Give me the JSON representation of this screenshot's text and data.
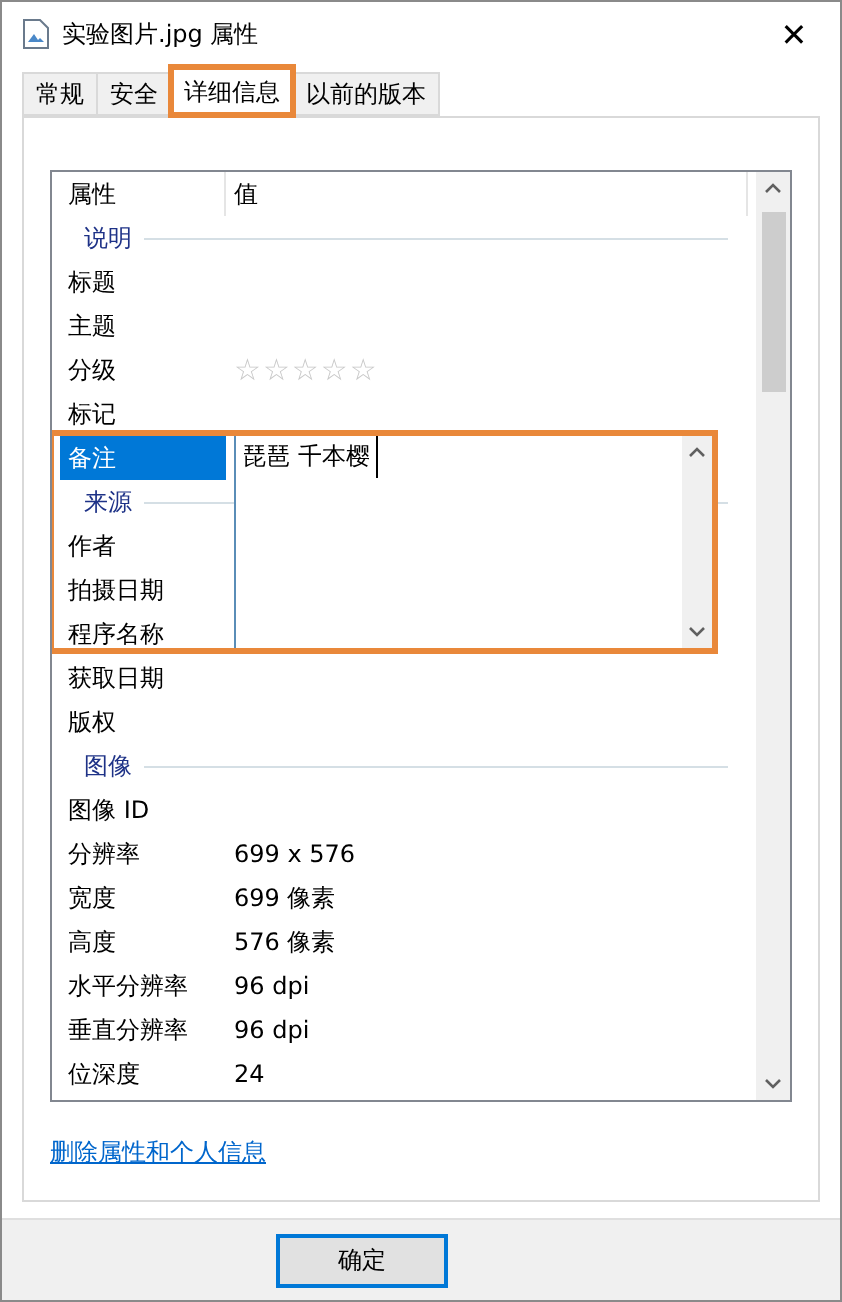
{
  "window": {
    "title": "实验图片.jpg 属性",
    "close": "✕"
  },
  "tabs": [
    {
      "label": "常规",
      "selected": false,
      "highlighted": false
    },
    {
      "label": "安全",
      "selected": false,
      "highlighted": false
    },
    {
      "label": "详细信息",
      "selected": true,
      "highlighted": true
    },
    {
      "label": "以前的版本",
      "selected": false,
      "highlighted": false
    }
  ],
  "list": {
    "columns": [
      "属性",
      "值"
    ],
    "rows": [
      {
        "kind": "group",
        "label": "说明"
      },
      {
        "kind": "property",
        "label": "标题",
        "selected": false
      },
      {
        "kind": "property",
        "label": "主题",
        "selected": false
      },
      {
        "kind": "rating",
        "label": "分级",
        "selected": false,
        "stars": 0
      },
      {
        "kind": "property",
        "label": "标记",
        "selected": false
      },
      {
        "kind": "property",
        "label": "备注",
        "selected": true,
        "highlighted": true,
        "editor": {
          "value": "琵琶 千本樱"
        }
      },
      {
        "kind": "group",
        "label": "来源"
      },
      {
        "kind": "property",
        "label": "作者",
        "selected": false
      },
      {
        "kind": "property",
        "label": "拍摄日期",
        "selected": false
      },
      {
        "kind": "property",
        "label": "程序名称",
        "selected": false
      },
      {
        "kind": "property",
        "label": "获取日期",
        "selected": false
      },
      {
        "kind": "property",
        "label": "版权",
        "selected": false
      },
      {
        "kind": "group",
        "label": "图像"
      },
      {
        "kind": "property",
        "label": "图像 ID",
        "selected": false
      },
      {
        "kind": "property",
        "label": "分辨率",
        "value": "699 x 576",
        "selected": false
      },
      {
        "kind": "property",
        "label": "宽度",
        "value": "699 像素",
        "selected": false
      },
      {
        "kind": "property",
        "label": "高度",
        "value": "576 像素",
        "selected": false
      },
      {
        "kind": "property",
        "label": "水平分辨率",
        "value": "96 dpi",
        "selected": false
      },
      {
        "kind": "property",
        "label": "垂直分辨率",
        "value": "96 dpi",
        "selected": false
      },
      {
        "kind": "property",
        "label": "位深度",
        "value": "24",
        "selected": false
      }
    ]
  },
  "link": "删除属性和个人信息",
  "buttons": [
    "确定"
  ]
}
